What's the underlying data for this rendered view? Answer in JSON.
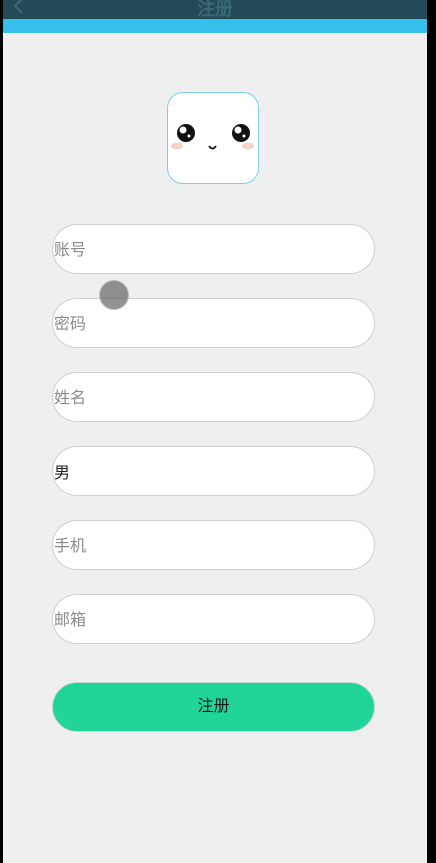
{
  "header": {
    "title": "注册",
    "back_icon": "chevron-left-icon"
  },
  "avatar": {
    "icon": "kawaii-face-icon"
  },
  "form": {
    "account_placeholder": "账号",
    "password_placeholder": "密码",
    "name_placeholder": "姓名",
    "gender_value": "男",
    "phone_placeholder": "手机",
    "email_placeholder": "邮箱"
  },
  "submit_label": "注册",
  "colors": {
    "titlebar": "#244a57",
    "accent": "#35c0ec",
    "button": "#21d49a",
    "background": "#f0efef"
  }
}
